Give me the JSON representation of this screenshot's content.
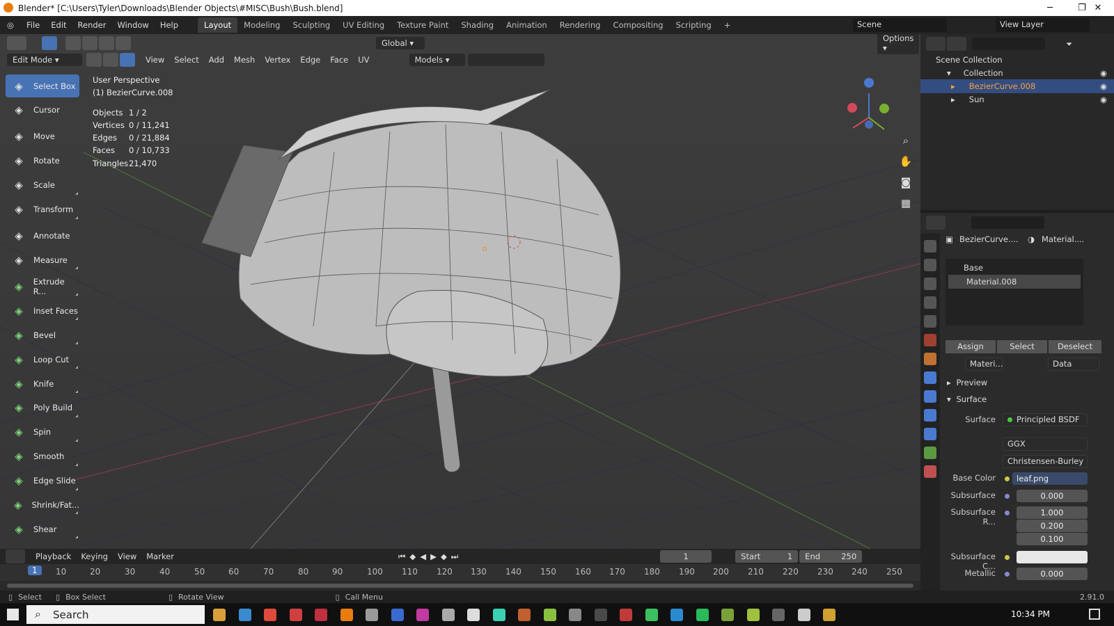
{
  "window": {
    "title": "Blender* [C:\\Users\\Tyler\\Downloads\\Blender Objects\\#MISC\\Bush\\Bush.blend]",
    "minimize": "─",
    "maximize": "❐",
    "close": "✕"
  },
  "menu": [
    "File",
    "Edit",
    "Render",
    "Window",
    "Help"
  ],
  "workspaces": [
    "Layout",
    "Modeling",
    "Sculpting",
    "UV Editing",
    "Texture Paint",
    "Shading",
    "Animation",
    "Rendering",
    "Compositing",
    "Scripting",
    "+"
  ],
  "scene": "Scene",
  "view_layer": "View Layer",
  "viewport_header": {
    "mode": "Edit Mode",
    "menus": [
      "View",
      "Select",
      "Add",
      "Mesh",
      "Vertex",
      "Edge",
      "Face",
      "UV"
    ],
    "orientation": "Global",
    "models": "Models",
    "options": "Options"
  },
  "tools": [
    {
      "label": "Select Box",
      "icon": "select-box-icon",
      "active": true
    },
    {
      "label": "Cursor",
      "icon": "cursor-icon"
    },
    {
      "label": "Move",
      "icon": "move-icon"
    },
    {
      "label": "Rotate",
      "icon": "rotate-icon"
    },
    {
      "label": "Scale",
      "icon": "scale-icon"
    },
    {
      "label": "Transform",
      "icon": "transform-icon"
    },
    {
      "label": "Annotate",
      "icon": "annotate-icon"
    },
    {
      "label": "Measure",
      "icon": "measure-icon"
    },
    {
      "label": "Extrude R...",
      "icon": "extrude-icon"
    },
    {
      "label": "Inset Faces",
      "icon": "inset-icon"
    },
    {
      "label": "Bevel",
      "icon": "bevel-icon"
    },
    {
      "label": "Loop Cut",
      "icon": "loopcut-icon"
    },
    {
      "label": "Knife",
      "icon": "knife-icon"
    },
    {
      "label": "Poly Build",
      "icon": "polybuild-icon"
    },
    {
      "label": "Spin",
      "icon": "spin-icon"
    },
    {
      "label": "Smooth",
      "icon": "smooth-icon"
    },
    {
      "label": "Edge Slide",
      "icon": "edgeslide-icon"
    },
    {
      "label": "Shrink/Fat...",
      "icon": "shrink-icon"
    },
    {
      "label": "Shear",
      "icon": "shear-icon"
    }
  ],
  "viewport_info": {
    "perspective": "User Perspective",
    "object": "(1) BezierCurve.008",
    "stats": [
      {
        "k": "Objects",
        "v": "1 / 2"
      },
      {
        "k": "Vertices",
        "v": "0 / 11,241"
      },
      {
        "k": "Edges",
        "v": "0 / 21,884"
      },
      {
        "k": "Faces",
        "v": "0 / 10,733"
      },
      {
        "k": "Triangles",
        "v": "21,470"
      }
    ]
  },
  "outliner": {
    "root": "Scene Collection",
    "collection": "Collection",
    "items": [
      "BezierCurve.008",
      "Sun"
    ]
  },
  "properties": {
    "object": "BezierCurve....",
    "material": "Material....",
    "slots": [
      "Base",
      "Material.008"
    ],
    "buttons": [
      "Assign",
      "Select",
      "Deselect"
    ],
    "mat_name": "Materi...",
    "data": "Data",
    "sections": [
      "Preview",
      "Surface"
    ],
    "surface_label": "Surface",
    "surface_value": "Principled BSDF",
    "ggx": "GGX",
    "subsurface_method": "Christensen-Burley",
    "fields": [
      {
        "label": "Base Color",
        "value": "leaf.png"
      },
      {
        "label": "Subsurface",
        "value": "0.000"
      },
      {
        "label": "Subsurface R...",
        "value": "1.000"
      },
      {
        "label": "",
        "value": "0.200"
      },
      {
        "label": "",
        "value": "0.100"
      },
      {
        "label": "Subsurface C...",
        "value": ""
      },
      {
        "label": "Metallic",
        "value": "0.000"
      }
    ]
  },
  "timeline": {
    "menus": [
      "Playback",
      "Keying",
      "View",
      "Marker"
    ],
    "current": "1",
    "start_label": "Start",
    "start": "1",
    "end_label": "End",
    "end": "250",
    "ticks": [
      "1",
      "10",
      "20",
      "30",
      "40",
      "50",
      "60",
      "70",
      "80",
      "90",
      "100",
      "110",
      "120",
      "130",
      "140",
      "150",
      "160",
      "170",
      "180",
      "190",
      "200",
      "210",
      "220",
      "230",
      "240",
      "250"
    ]
  },
  "status": {
    "select": "Select",
    "box": "Box Select",
    "rotate": "Rotate View",
    "call": "Call Menu",
    "version": "2.91.0"
  },
  "taskbar": {
    "search": "Search",
    "time": "10:34 PM"
  },
  "colors": {
    "accent": "#4772b3",
    "viewport": "#393939",
    "panel": "#2b2b2b"
  }
}
